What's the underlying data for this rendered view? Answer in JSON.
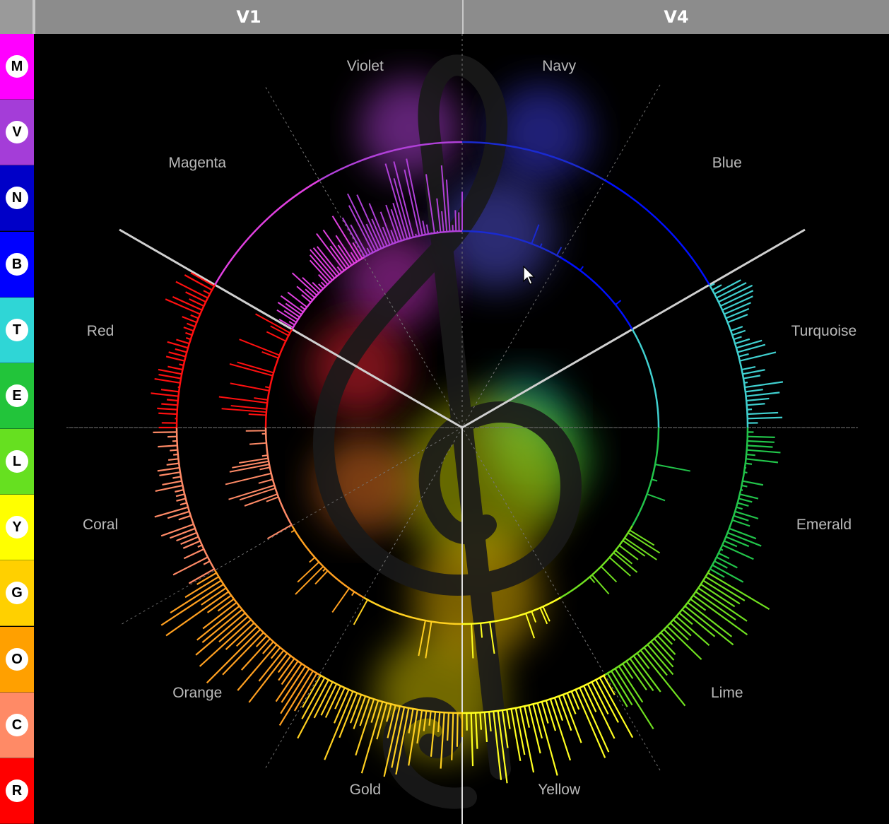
{
  "header": {
    "columns": [
      {
        "label": "V1"
      },
      {
        "label": "V4"
      }
    ]
  },
  "sidebar": {
    "items": [
      {
        "letter": "M",
        "color": "#ff00ff"
      },
      {
        "letter": "V",
        "color": "#a43dd8"
      },
      {
        "letter": "N",
        "color": "#0000c8"
      },
      {
        "letter": "B",
        "color": "#0000ff"
      },
      {
        "letter": "T",
        "color": "#2fd6d6"
      },
      {
        "letter": "E",
        "color": "#22c43a"
      },
      {
        "letter": "L",
        "color": "#66e020"
      },
      {
        "letter": "Y",
        "color": "#ffff00"
      },
      {
        "letter": "G",
        "color": "#ffd000"
      },
      {
        "letter": "O",
        "color": "#ffa000"
      },
      {
        "letter": "C",
        "color": "#ff8a66"
      },
      {
        "letter": "R",
        "color": "#ff0000"
      }
    ]
  },
  "wheel": {
    "sectors": [
      {
        "label": "Navy",
        "color": "#1a2ad0"
      },
      {
        "label": "Blue",
        "color": "#0010ff"
      },
      {
        "label": "Turquoise",
        "color": "#40d0d0"
      },
      {
        "label": "Emerald",
        "color": "#22c44a"
      },
      {
        "label": "Lime",
        "color": "#70e020"
      },
      {
        "label": "Yellow",
        "color": "#ffff20"
      },
      {
        "label": "Gold",
        "color": "#ffd020"
      },
      {
        "label": "Orange",
        "color": "#ffa020"
      },
      {
        "label": "Coral",
        "color": "#ff8a66"
      },
      {
        "label": "Red",
        "color": "#ff1010"
      },
      {
        "label": "Magenta",
        "color": "#e040e0"
      },
      {
        "label": "Violet",
        "color": "#b040d8"
      }
    ],
    "symbol": "treble-clef-icon"
  }
}
